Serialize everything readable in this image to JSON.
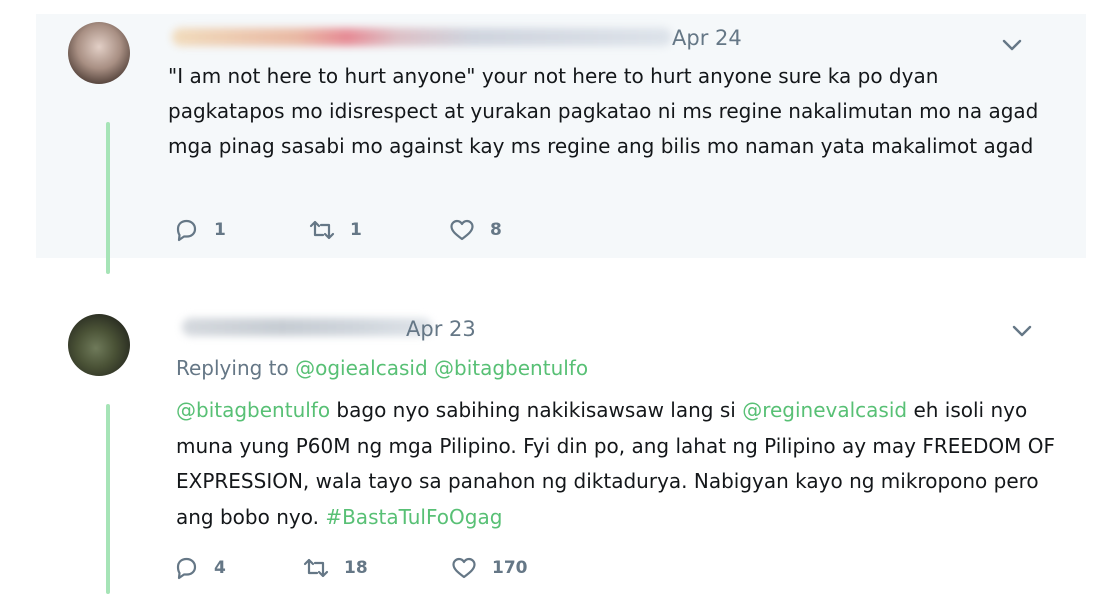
{
  "tweets": [
    {
      "date": "Apr 24",
      "text": "\"I am not here to hurt anyone\" your not here to hurt anyone sure ka po  dyan pagkatapos mo idisrespect at yurakan pagkatao ni ms regine nakalimutan mo na agad mga pinag sasabi mo against kay ms regine ang bilis mo naman yata makalimot agad",
      "replies": "1",
      "retweets": "1",
      "likes": "8"
    },
    {
      "date": "Apr 23",
      "replying_label": "Replying to",
      "replying_mentions": [
        "@ogiealcasid",
        "@bitagbentulfo"
      ],
      "text_parts": {
        "mention1": "@bitagbentulfo",
        "t1": " bago nyo sabihing nakikisawsaw lang si ",
        "mention2": "@reginevalcasid",
        "t2": " eh isoli nyo muna yung P60M ng mga Pilipino. Fyi din po, ang lahat ng Pilipino ay may FREEDOM OF EXPRESSION, wala tayo sa panahon ng diktadurya. Nabigyan kayo ng mikropono pero ang bobo nyo. ",
        "hashtag": "#BastaTulFoOgag"
      },
      "replies": "4",
      "retweets": "18",
      "likes": "170"
    }
  ],
  "colors": {
    "accent_green": "#58c075",
    "thread_line": "#a6e4b7",
    "muted": "#657786",
    "highlight_bg": "#f5f8fa"
  }
}
